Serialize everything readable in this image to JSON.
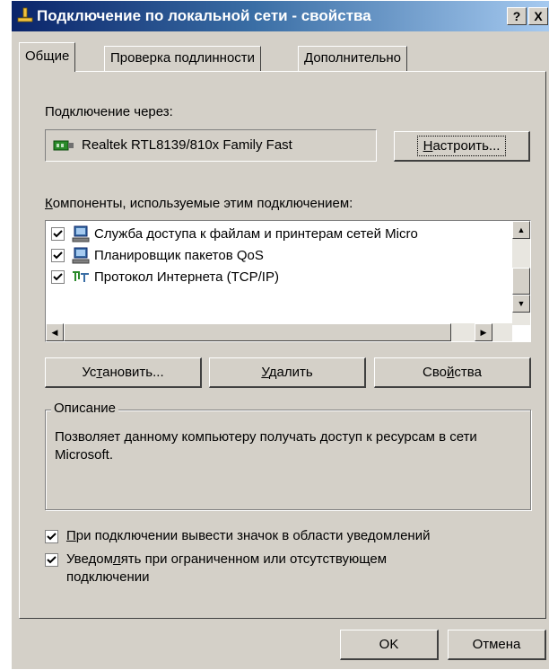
{
  "window": {
    "title": "Подключение по локальной сети - свойства",
    "help_button": "?",
    "close_button": "X"
  },
  "tabs": [
    {
      "label": "Общие",
      "active": true
    },
    {
      "label": "Проверка подлинности",
      "active": false
    },
    {
      "label": "Дополнительно",
      "active": false
    }
  ],
  "connect_via": {
    "label": "Подключение через:",
    "adapter_name": "Realtek RTL8139/810x Family Fast",
    "configure_button": "Настроить...",
    "configure_mnemonic": "Н",
    "configure_rest": "астроить..."
  },
  "components": {
    "label_mnemonic": "К",
    "label_rest": "омпоненты, используемые этим подключением:",
    "items": [
      {
        "text": "Служба доступа к файлам и принтерам сетей Micro",
        "checked": true,
        "icon": "network-computer-icon"
      },
      {
        "text": "Планировщик пакетов QoS",
        "checked": true,
        "icon": "network-computer-icon"
      },
      {
        "text": "Протокол Интернета (TCP/IP)",
        "checked": true,
        "icon": "protocol-icon"
      }
    ]
  },
  "actions": {
    "install_pre": "Ус",
    "install_mnemonic": "т",
    "install_post": "ановить...",
    "remove_mnemonic": "У",
    "remove_rest": "далить",
    "properties_pre": "Сво",
    "properties_mnemonic": "й",
    "properties_post": "ства"
  },
  "description": {
    "legend": "Описание",
    "text": "Позволяет данному компьютеру получать доступ к ресурсам в сети Microsoft."
  },
  "options": {
    "show_icon_mnemonic": "П",
    "show_icon_rest": "ри подключении вывести значок в области уведомлений",
    "show_icon_checked": true,
    "notify_pre": "Уведом",
    "notify_mnemonic": "л",
    "notify_post": "ять при ограниченном или отсутствующем",
    "notify_line2": "подключении",
    "notify_checked": true
  },
  "footer": {
    "ok_label": "OK",
    "cancel_label": "Отмена"
  },
  "colors": {
    "face": "#d4d0c8",
    "title_start": "#0a246a",
    "title_end": "#a6caf0"
  }
}
